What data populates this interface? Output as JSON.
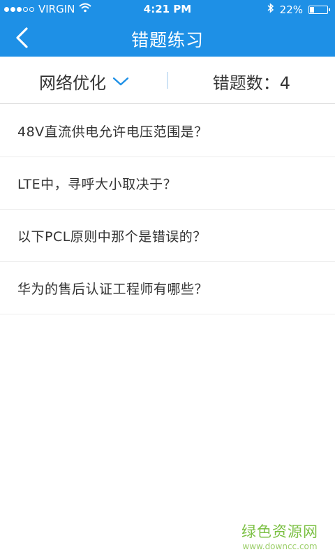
{
  "status_bar": {
    "carrier": "VIRGIN",
    "time": "4:21 PM",
    "battery": "22%",
    "signal_dots": [
      "filled",
      "filled",
      "filled",
      "empty",
      "empty"
    ]
  },
  "nav": {
    "back_icon": "chevron-left-icon",
    "title": "错题练习"
  },
  "filter": {
    "category": "网络优化",
    "count_label": "错题数：4"
  },
  "questions": [
    "48V直流供电允许电压范围是？",
    "LTE中，寻呼大小取决于？",
    "以下PCL原则中那个是错误的？",
    "华为的售后认证工程师有哪些？"
  ],
  "watermark": {
    "title": "绿色资源网",
    "url": "www.downcc.com"
  },
  "colors": {
    "primary": "#1e90e6",
    "text": "#333333",
    "divider": "#ececec",
    "watermark": "#7bc043"
  }
}
